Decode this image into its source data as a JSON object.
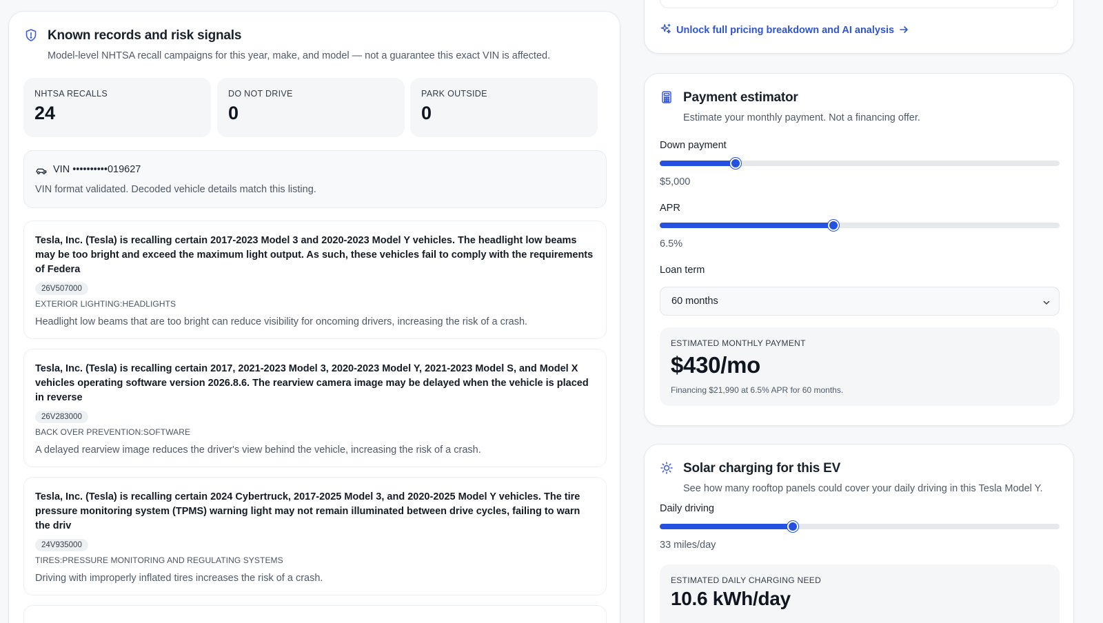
{
  "records": {
    "title": "Known records and risk signals",
    "subtitle": "Model-level NHTSA recall campaigns for this year, make, and model — not a guarantee this exact VIN is affected.",
    "stats": [
      {
        "label": "NHTSA RECALLS",
        "value": "24"
      },
      {
        "label": "DO NOT DRIVE",
        "value": "0"
      },
      {
        "label": "PARK OUTSIDE",
        "value": "0"
      }
    ],
    "vin": {
      "label": "VIN ••••••••••019627",
      "note": "VIN format validated. Decoded vehicle details match this listing."
    },
    "recalls": [
      {
        "summary": "Tesla, Inc. (Tesla) is recalling certain 2017-2023 Model 3 and 2020-2023 Model Y vehicles. The headlight low beams may be too bright and exceed the maximum light output. As such, these vehicles fail to comply with the requirements of Federa",
        "campaign": "26V507000",
        "component": "EXTERIOR LIGHTING:HEADLIGHTS",
        "consequence": "Headlight low beams that are too bright can reduce visibility for oncoming drivers, increasing the risk of a crash."
      },
      {
        "summary": "Tesla, Inc. (Tesla) is recalling certain 2017, 2021-2023 Model 3, 2020-2023 Model Y, 2021-2023 Model S, and Model X vehicles operating software version 2026.8.6. The rearview camera image may be delayed when the vehicle is placed in reverse",
        "campaign": "26V283000",
        "component": "BACK OVER PREVENTION:SOFTWARE",
        "consequence": "A delayed rearview image reduces the driver's view behind the vehicle, increasing the risk of a crash."
      },
      {
        "summary": "Tesla, Inc. (Tesla) is recalling certain 2024 Cybertruck, 2017-2025 Model 3, and 2020-2025 Model Y vehicles. The tire pressure monitoring system (TPMS) warning light may not remain illuminated between drive cycles, failing to warn the driv",
        "campaign": "24V935000",
        "component": "TIRES:PRESSURE MONITORING AND REGULATING SYSTEMS",
        "consequence": "Driving with improperly inflated tires increases the risk of a crash."
      }
    ]
  },
  "unlock": {
    "label": "Unlock full pricing breakdown and AI analysis"
  },
  "payment": {
    "title": "Payment estimator",
    "subtitle": "Estimate your monthly payment. Not a financing offer.",
    "down_payment": {
      "label": "Down payment",
      "value": "$5,000",
      "fraction": 0.19
    },
    "apr": {
      "label": "APR",
      "value": "6.5%",
      "fraction": 0.435
    },
    "loan_term": {
      "label": "Loan term",
      "selected": "60 months"
    },
    "estimate": {
      "label": "ESTIMATED MONTHLY PAYMENT",
      "value": "$430/mo",
      "note": "Financing $21,990 at 6.5% APR for 60 months."
    }
  },
  "solar": {
    "title": "Solar charging for this EV",
    "subtitle": "See how many rooftop panels could cover your daily driving in this Tesla Model Y.",
    "daily_driving": {
      "label": "Daily driving",
      "value": "33 miles/day",
      "fraction": 0.333
    },
    "estimate": {
      "label": "ESTIMATED DAILY CHARGING NEED",
      "value": "10.6 kWh/day"
    }
  },
  "colors": {
    "accent": "#2451e0",
    "link": "#2f55d4",
    "icon": "#3b5bdb"
  }
}
